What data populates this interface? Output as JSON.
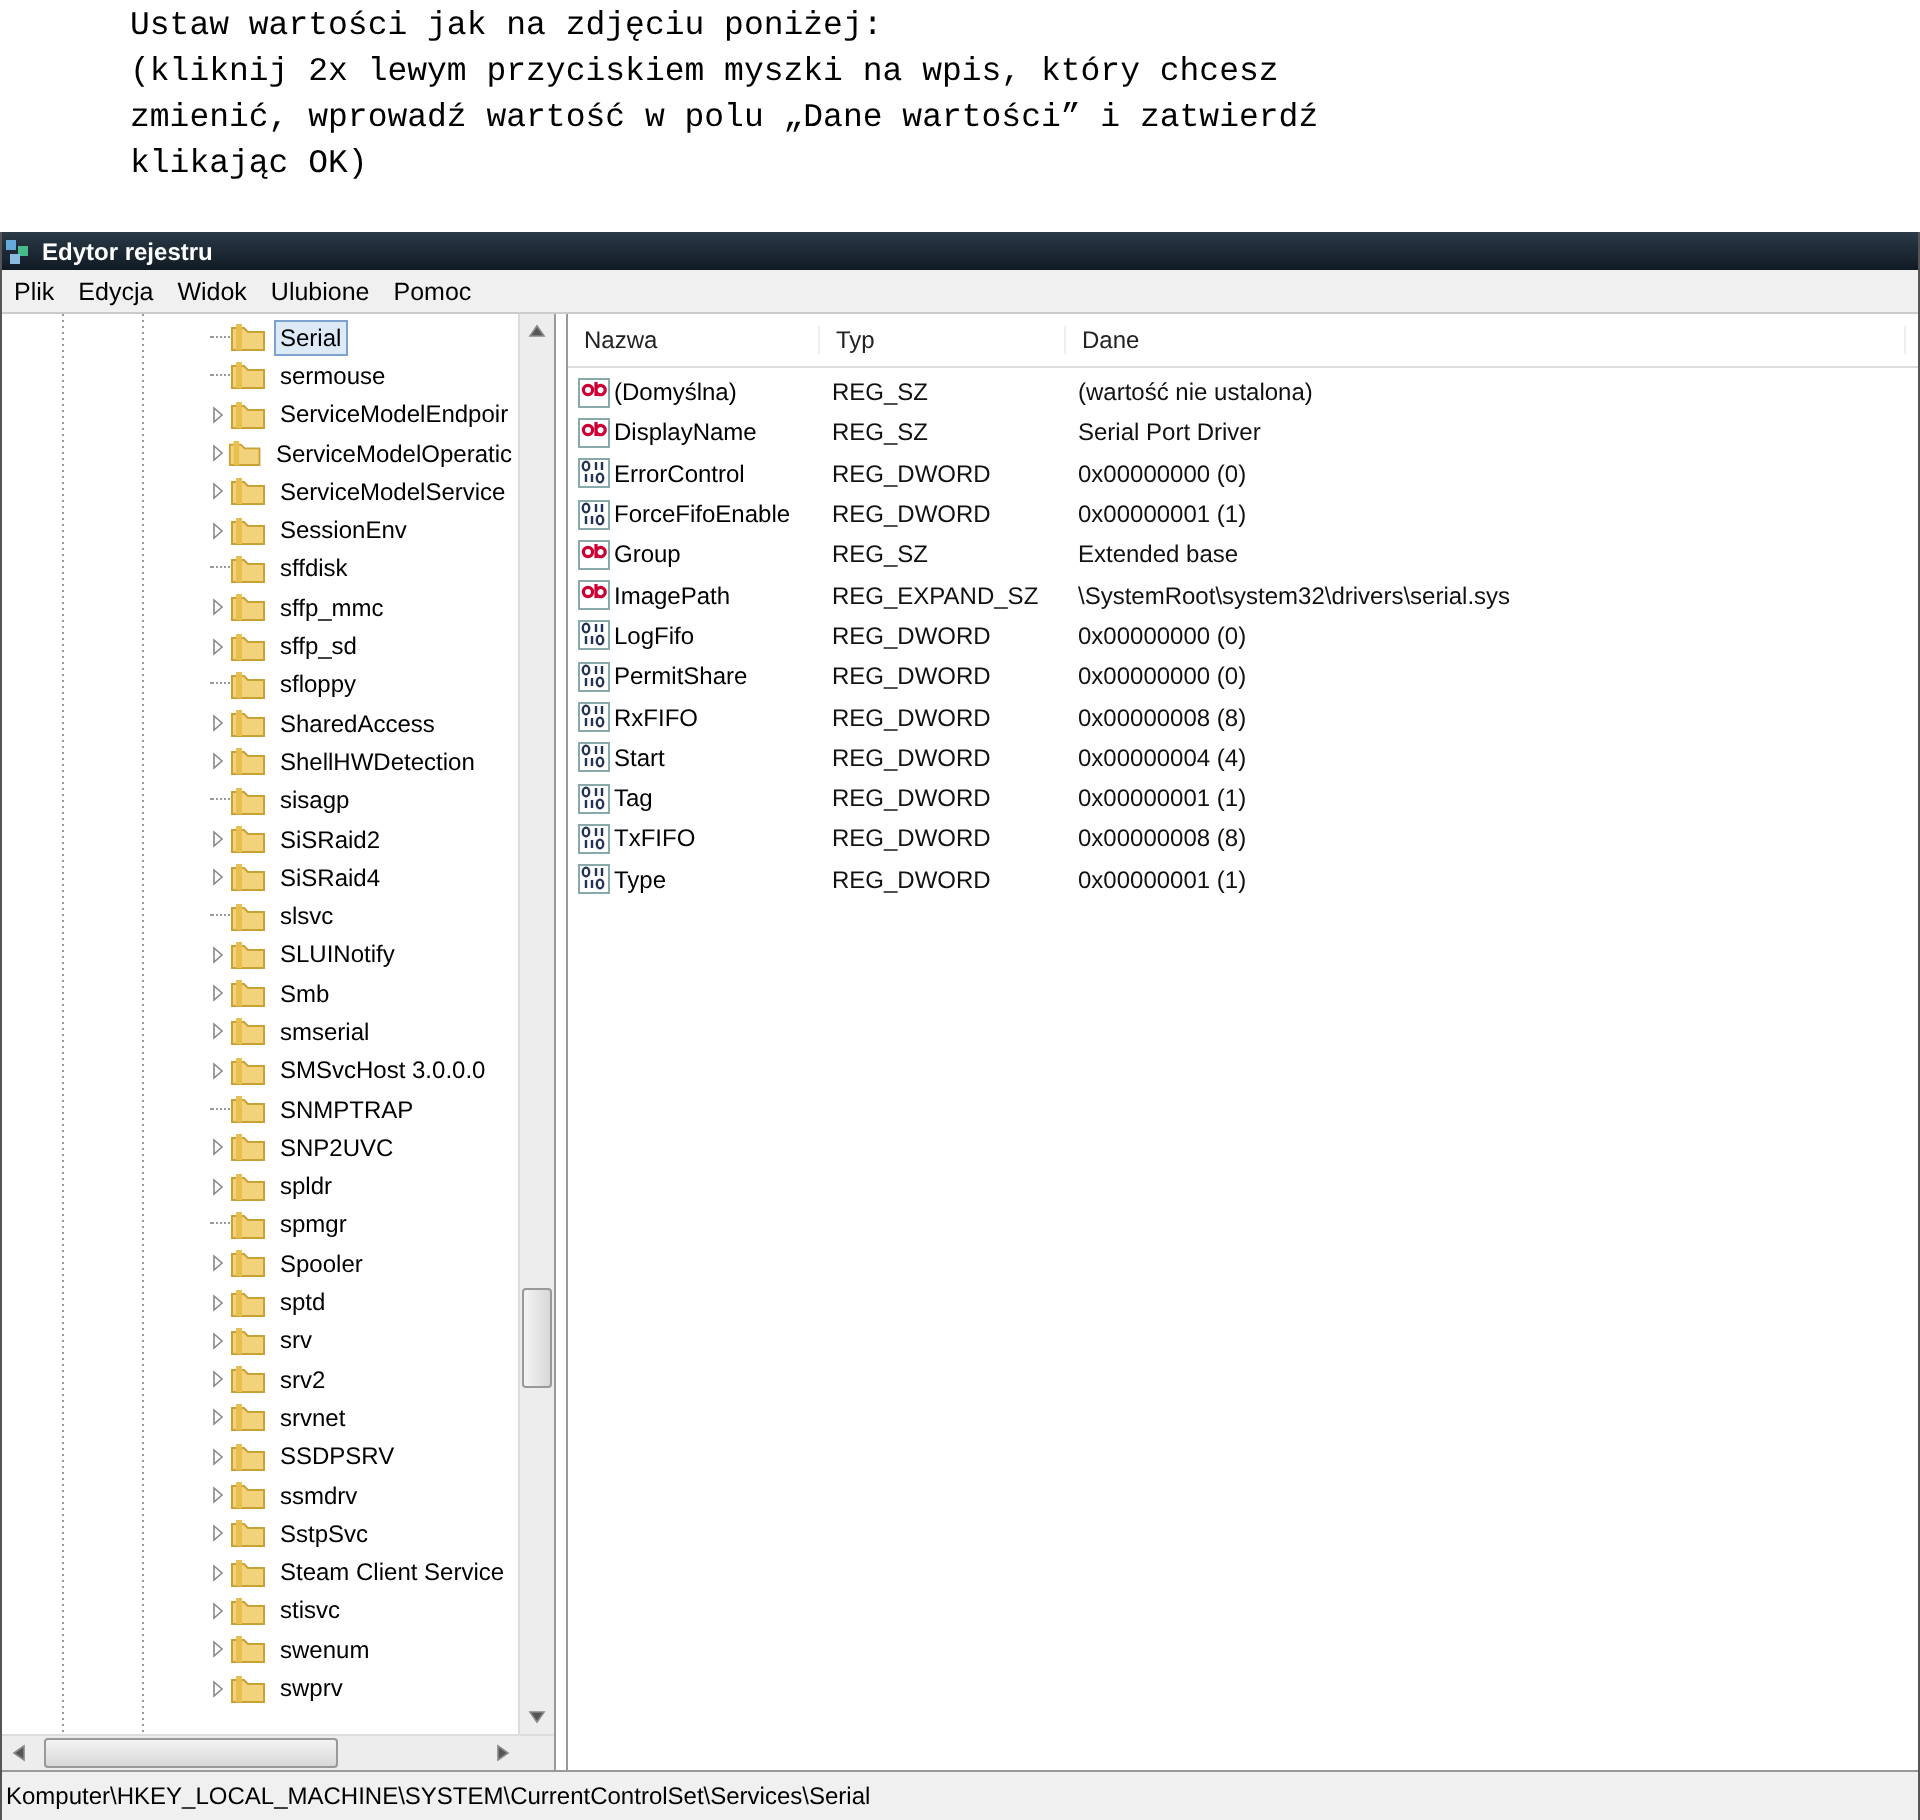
{
  "instructions": [
    "Ustaw wartości jak na zdjęciu poniżej:",
    "(kliknij 2x lewym przyciskiem myszki na wpis, który chcesz",
    "zmienić, wprowadź wartość w polu „Dane wartości” i zatwierdź",
    "klikając OK)"
  ],
  "window": {
    "title": "Edytor rejestru"
  },
  "menu": [
    "Plik",
    "Edycja",
    "Widok",
    "Ulubione",
    "Pomoc"
  ],
  "tree": [
    {
      "label": "Serial",
      "expandable": false,
      "selected": true
    },
    {
      "label": "sermouse",
      "expandable": false,
      "selected": false
    },
    {
      "label": "ServiceModelEndpoir",
      "expandable": true,
      "selected": false
    },
    {
      "label": "ServiceModelOperatic",
      "expandable": true,
      "selected": false
    },
    {
      "label": "ServiceModelService",
      "expandable": true,
      "selected": false
    },
    {
      "label": "SessionEnv",
      "expandable": true,
      "selected": false
    },
    {
      "label": "sffdisk",
      "expandable": false,
      "selected": false
    },
    {
      "label": "sffp_mmc",
      "expandable": true,
      "selected": false
    },
    {
      "label": "sffp_sd",
      "expandable": true,
      "selected": false
    },
    {
      "label": "sfloppy",
      "expandable": false,
      "selected": false
    },
    {
      "label": "SharedAccess",
      "expandable": true,
      "selected": false
    },
    {
      "label": "ShellHWDetection",
      "expandable": true,
      "selected": false
    },
    {
      "label": "sisagp",
      "expandable": false,
      "selected": false
    },
    {
      "label": "SiSRaid2",
      "expandable": true,
      "selected": false
    },
    {
      "label": "SiSRaid4",
      "expandable": true,
      "selected": false
    },
    {
      "label": "slsvc",
      "expandable": false,
      "selected": false
    },
    {
      "label": "SLUINotify",
      "expandable": true,
      "selected": false
    },
    {
      "label": "Smb",
      "expandable": true,
      "selected": false
    },
    {
      "label": "smserial",
      "expandable": true,
      "selected": false
    },
    {
      "label": "SMSvcHost 3.0.0.0",
      "expandable": true,
      "selected": false
    },
    {
      "label": "SNMPTRAP",
      "expandable": false,
      "selected": false
    },
    {
      "label": "SNP2UVC",
      "expandable": true,
      "selected": false
    },
    {
      "label": "spldr",
      "expandable": true,
      "selected": false
    },
    {
      "label": "spmgr",
      "expandable": false,
      "selected": false
    },
    {
      "label": "Spooler",
      "expandable": true,
      "selected": false
    },
    {
      "label": "sptd",
      "expandable": true,
      "selected": false
    },
    {
      "label": "srv",
      "expandable": true,
      "selected": false
    },
    {
      "label": "srv2",
      "expandable": true,
      "selected": false
    },
    {
      "label": "srvnet",
      "expandable": true,
      "selected": false
    },
    {
      "label": "SSDPSRV",
      "expandable": true,
      "selected": false
    },
    {
      "label": "ssmdrv",
      "expandable": true,
      "selected": false
    },
    {
      "label": "SstpSvc",
      "expandable": true,
      "selected": false
    },
    {
      "label": "Steam Client Service",
      "expandable": true,
      "selected": false
    },
    {
      "label": "stisvc",
      "expandable": true,
      "selected": false
    },
    {
      "label": "swenum",
      "expandable": true,
      "selected": false
    },
    {
      "label": "swprv",
      "expandable": true,
      "selected": false
    }
  ],
  "table": {
    "columns": [
      "Nazwa",
      "Typ",
      "Dane"
    ],
    "rows": [
      {
        "kind": "string",
        "name": "(Domyślna)",
        "type": "REG_SZ",
        "data": "(wartość nie ustalona)"
      },
      {
        "kind": "string",
        "name": "DisplayName",
        "type": "REG_SZ",
        "data": "Serial Port Driver"
      },
      {
        "kind": "binary",
        "name": "ErrorControl",
        "type": "REG_DWORD",
        "data": "0x00000000 (0)"
      },
      {
        "kind": "binary",
        "name": "ForceFifoEnable",
        "type": "REG_DWORD",
        "data": "0x00000001 (1)"
      },
      {
        "kind": "string",
        "name": "Group",
        "type": "REG_SZ",
        "data": "Extended base"
      },
      {
        "kind": "string",
        "name": "ImagePath",
        "type": "REG_EXPAND_SZ",
        "data": "\\SystemRoot\\system32\\drivers\\serial.sys"
      },
      {
        "kind": "binary",
        "name": "LogFifo",
        "type": "REG_DWORD",
        "data": "0x00000000 (0)"
      },
      {
        "kind": "binary",
        "name": "PermitShare",
        "type": "REG_DWORD",
        "data": "0x00000000 (0)"
      },
      {
        "kind": "binary",
        "name": "RxFIFO",
        "type": "REG_DWORD",
        "data": "0x00000008 (8)"
      },
      {
        "kind": "binary",
        "name": "Start",
        "type": "REG_DWORD",
        "data": "0x00000004 (4)"
      },
      {
        "kind": "binary",
        "name": "Tag",
        "type": "REG_DWORD",
        "data": "0x00000001 (1)"
      },
      {
        "kind": "binary",
        "name": "TxFIFO",
        "type": "REG_DWORD",
        "data": "0x00000008 (8)"
      },
      {
        "kind": "binary",
        "name": "Type",
        "type": "REG_DWORD",
        "data": "0x00000001 (1)"
      }
    ]
  },
  "status_bar": "Komputer\\HKEY_LOCAL_MACHINE\\SYSTEM\\CurrentControlSet\\Services\\Serial"
}
